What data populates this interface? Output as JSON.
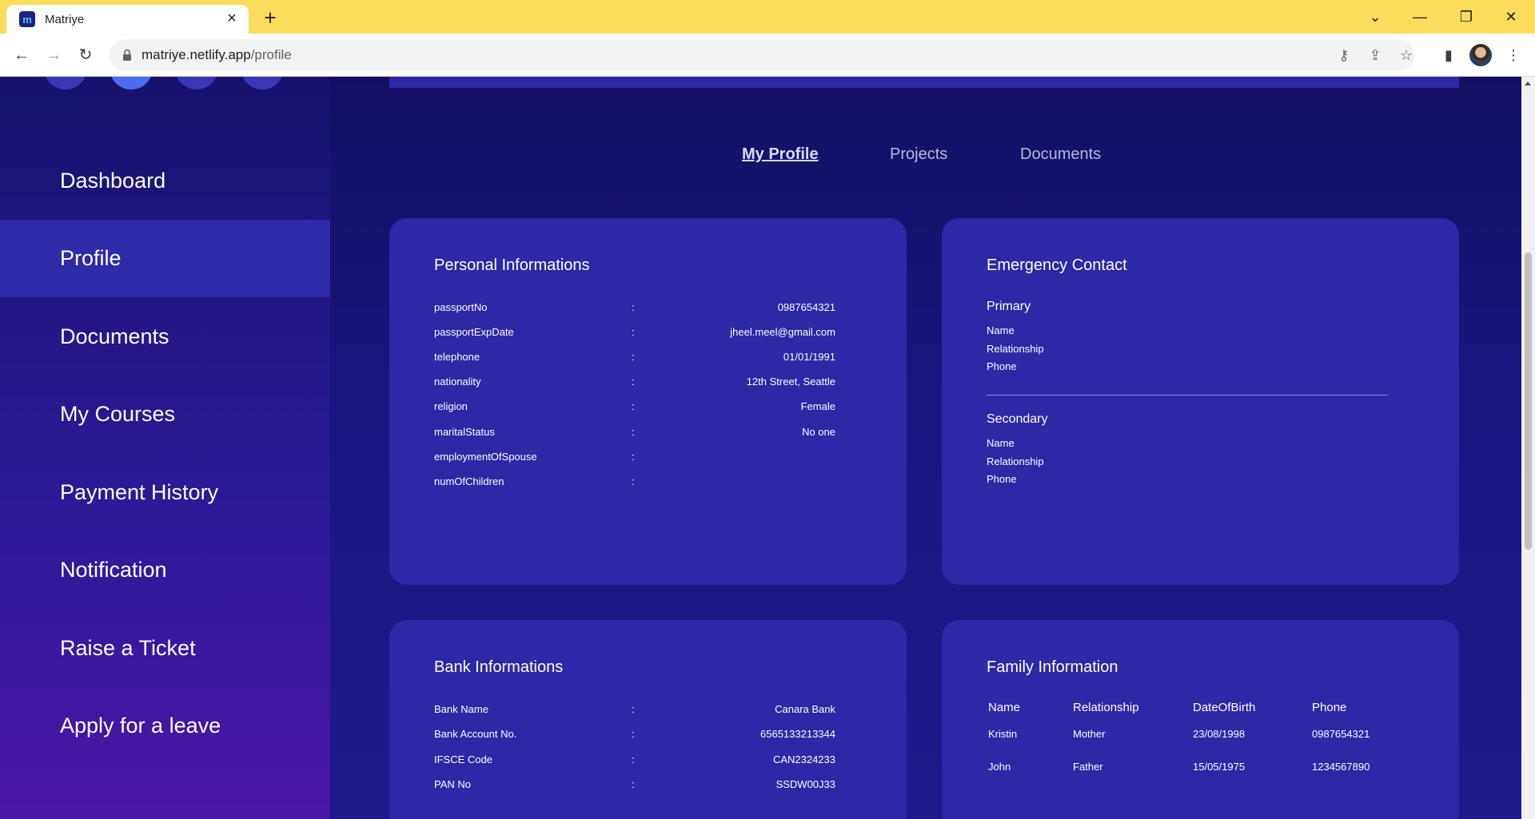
{
  "browser": {
    "tab_title": "Matriye",
    "url_host": "matriye.netlify.app",
    "url_path": "/profile"
  },
  "sidebar": {
    "items": [
      {
        "label": "Dashboard"
      },
      {
        "label": "Profile",
        "active": true
      },
      {
        "label": "Documents"
      },
      {
        "label": "My Courses"
      },
      {
        "label": "Payment History"
      },
      {
        "label": "Notification"
      },
      {
        "label": "Raise a Ticket"
      },
      {
        "label": "Apply for a leave"
      }
    ]
  },
  "profile_tabs": [
    {
      "label": "My Profile",
      "active": true
    },
    {
      "label": "Projects"
    },
    {
      "label": "Documents"
    }
  ],
  "personal": {
    "title": "Personal Informations",
    "rows": [
      {
        "key": "passportNo",
        "value": "0987654321"
      },
      {
        "key": "passportExpDate",
        "value": "jheel.meel@gmail.com"
      },
      {
        "key": "telephone",
        "value": "01/01/1991"
      },
      {
        "key": "nationality",
        "value": "12th Street, Seattle"
      },
      {
        "key": "religion",
        "value": "Female"
      },
      {
        "key": "maritalStatus",
        "value": "No one"
      },
      {
        "key": "employmentOfSpouse",
        "value": ""
      },
      {
        "key": "numOfChildren",
        "value": ""
      }
    ]
  },
  "emergency": {
    "title": "Emergency Contact",
    "primary": {
      "heading": "Primary",
      "fields": [
        "Name",
        "Relationship",
        "Phone"
      ]
    },
    "secondary": {
      "heading": "Secondary",
      "fields": [
        "Name",
        "Relationship",
        "Phone"
      ]
    }
  },
  "bank": {
    "title": "Bank Informations",
    "rows": [
      {
        "key": "Bank Name",
        "value": "Canara Bank"
      },
      {
        "key": "Bank Account No.",
        "value": "6565133213344"
      },
      {
        "key": "IFSCE Code",
        "value": "CAN2324233"
      },
      {
        "key": "PAN No",
        "value": "SSDW00J33"
      }
    ]
  },
  "family": {
    "title": "Family Information",
    "headers": [
      "Name",
      "Relationship",
      "DateOfBirth",
      "Phone"
    ],
    "rows": [
      [
        "Kristin",
        "Mother",
        "23/08/1998",
        "0987654321"
      ],
      [
        "John",
        "Father",
        "15/05/1975",
        "1234567890"
      ]
    ]
  },
  "separator": ":"
}
